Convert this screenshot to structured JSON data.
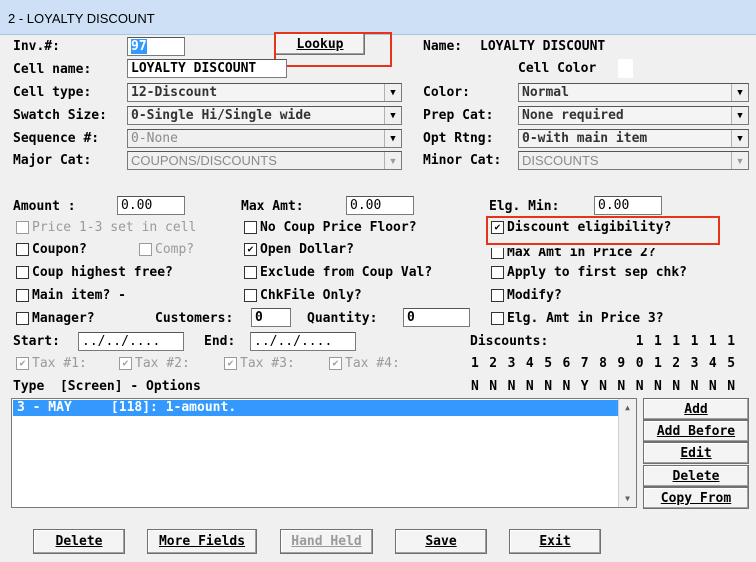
{
  "window": {
    "title": "2 - LOYALTY DISCOUNT"
  },
  "form": {
    "inv_label": "Inv.#:",
    "inv_value": "97",
    "lookup_label": "Lookup",
    "name_label": "Name:",
    "name_value": "LOYALTY DISCOUNT",
    "cell_name_label": "Cell name:",
    "cell_name_value": "LOYALTY DISCOUNT",
    "cell_color_label": "Cell Color",
    "cell_type_label": "Cell type:",
    "cell_type_value": "12-Discount",
    "color_label": "Color:",
    "color_value": "Normal",
    "swatch_label": "Swatch Size:",
    "swatch_value": "0-Single Hi/Single wide",
    "prep_cat_label": "Prep Cat:",
    "prep_cat_value": "None required",
    "sequence_label": "Sequence #:",
    "sequence_value": "0-None",
    "opt_rtng_label": "Opt Rtng:",
    "opt_rtng_value": "0-with main item",
    "major_cat_label": "Major Cat:",
    "major_cat_value": "COUPONS/DISCOUNTS",
    "minor_cat_label": "Minor Cat:",
    "minor_cat_value": "DISCOUNTS",
    "amount_label": "Amount :",
    "amount_value": "0.00",
    "max_amt_label": "Max Amt:",
    "max_amt_value": "0.00",
    "elg_min_label": "Elg. Min:",
    "elg_min_value": "0.00",
    "customers_label": "Customers:",
    "customers_value": "0",
    "quantity_label": "Quantity:",
    "quantity_value": "0",
    "start_label": "Start:",
    "start_value": "../../....",
    "end_label": "End:",
    "end_value": "../../....",
    "discounts_label": "Discounts:"
  },
  "checkboxes": {
    "price13": {
      "label": "Price 1-3 set in cell",
      "mark": ""
    },
    "no_coup_floor": {
      "label": "No Coup Price Floor?",
      "mark": ""
    },
    "discount_elig": {
      "label": "Discount eligibility?",
      "mark": "✔"
    },
    "coupon": {
      "label": "Coupon?",
      "mark": ""
    },
    "comp": {
      "label": "Comp?",
      "mark": ""
    },
    "open_dollar": {
      "label": "Open Dollar?",
      "mark": "✔"
    },
    "max_amt_price2": {
      "label": "Max Amt in Price 2?",
      "mark": ""
    },
    "coup_highest": {
      "label": "Coup highest free?",
      "mark": ""
    },
    "exclude_coup": {
      "label": "Exclude from Coup Val?",
      "mark": ""
    },
    "apply_first": {
      "label": "Apply to first sep chk?",
      "mark": ""
    },
    "main_item": {
      "label": "Main item? -",
      "mark": ""
    },
    "chkfile": {
      "label": "ChkFile Only?",
      "mark": ""
    },
    "modify": {
      "label": "Modify?",
      "mark": ""
    },
    "manager": {
      "label": "Manager?",
      "mark": ""
    },
    "elg_amt_price3": {
      "label": "Elg. Amt in Price 3?",
      "mark": ""
    },
    "tax1": {
      "label": "Tax #1:",
      "mark": "✔"
    },
    "tax2": {
      "label": "Tax #2:",
      "mark": "✔"
    },
    "tax3": {
      "label": "Tax #3:",
      "mark": "✔"
    },
    "tax4": {
      "label": "Tax #4:",
      "mark": "✔"
    }
  },
  "discounts": {
    "tens": [
      "",
      "",
      "",
      "",
      "",
      "",
      "",
      "",
      "",
      "1",
      "1",
      "1",
      "1",
      "1",
      "1"
    ],
    "ones": [
      "1",
      "2",
      "3",
      "4",
      "5",
      "6",
      "7",
      "8",
      "9",
      "0",
      "1",
      "2",
      "3",
      "4",
      "5"
    ],
    "flags": [
      "N",
      "N",
      "N",
      "N",
      "N",
      "N",
      "Y",
      "N",
      "N",
      "N",
      "N",
      "N",
      "N",
      "N",
      "N"
    ]
  },
  "options": {
    "header": "Type  [Screen] - Options",
    "rows": [
      "3 - MAY     [118]: 1-amount."
    ]
  },
  "side_buttons": {
    "add": "Add",
    "add_before": "Add Before",
    "edit": "Edit",
    "delete": "Delete",
    "copy_from": "Copy From"
  },
  "bottom_buttons": {
    "delete": "Delete",
    "more_fields": "More Fields",
    "hand_held": "Hand Held",
    "save": "Save",
    "exit": "Exit"
  }
}
